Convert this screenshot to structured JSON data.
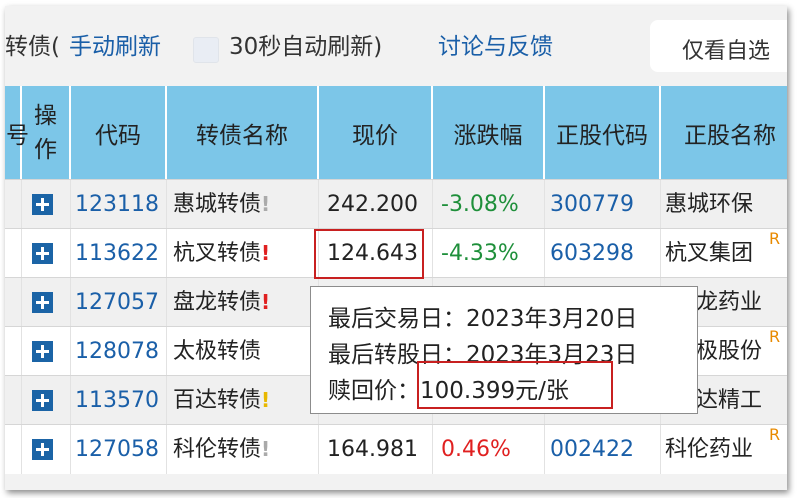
{
  "toolbar": {
    "title_prefix": "转债(",
    "manual_refresh": "手动刷新",
    "auto_refresh": "30秒自动刷新)",
    "discuss": "讨论与反馈",
    "only_favorites": "仅看自选"
  },
  "columns": {
    "partial": "号",
    "op": "操作",
    "code": "代码",
    "name": "转债名称",
    "price": "现价",
    "change": "涨跌幅",
    "stock_code": "正股代码",
    "stock_name": "正股名称"
  },
  "rows": [
    {
      "code": "123118",
      "name": "惠城转债",
      "excl": "!",
      "excl_color": "gray",
      "price": "242.200",
      "change": "-3.08%",
      "change_color": "green",
      "stock_code": "300779",
      "stock_name": "惠城环保",
      "r": ""
    },
    {
      "code": "113622",
      "name": "杭叉转债",
      "excl": "!",
      "excl_color": "red",
      "price": "124.643",
      "change": "-4.33%",
      "change_color": "green",
      "stock_code": "603298",
      "stock_name": "杭叉集团",
      "r": "R"
    },
    {
      "code": "127057",
      "name": "盘龙转债",
      "excl": "!",
      "excl_color": "red",
      "price": "",
      "change": "",
      "change_color": "green",
      "stock_code": "",
      "stock_name": "龙药业",
      "r": ""
    },
    {
      "code": "128078",
      "name": "太极转债",
      "excl": "",
      "excl_color": "gray",
      "price": "",
      "change": "",
      "change_color": "green",
      "stock_code": "",
      "stock_name": "极股份",
      "r": "R"
    },
    {
      "code": "113570",
      "name": "百达转债",
      "excl": "!",
      "excl_color": "yellow",
      "price": "",
      "change": "",
      "change_color": "green",
      "stock_code": "",
      "stock_name": "达精工",
      "r": ""
    },
    {
      "code": "127058",
      "name": "科伦转债",
      "excl": "!",
      "excl_color": "gray",
      "price": "164.981",
      "change": "0.46%",
      "change_color": "red",
      "stock_code": "002422",
      "stock_name": "科伦药业",
      "r": "R"
    }
  ],
  "tooltip": {
    "last_trade": "最后交易日：2023年3月20日",
    "last_convert": "最后转股日：2023年3月23日",
    "redeem_label": "赎回价：",
    "redeem_value": "100.399元/张"
  }
}
